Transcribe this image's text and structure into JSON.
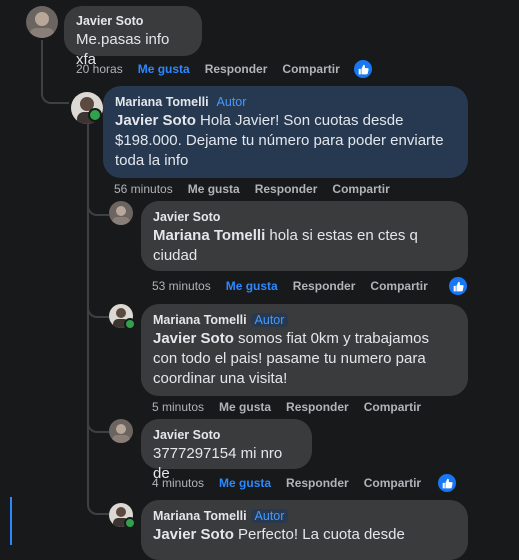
{
  "comments": [
    {
      "author": "Javier Soto",
      "text": "Me.pasas info xfa",
      "time": "20 horas"
    },
    {
      "author": "Mariana Tomelli",
      "badge": "Autor",
      "mention": "Javier Soto",
      "text": " Hola Javier! Son cuotas desde $198.000. Dejame tu número para poder enviarte toda la info",
      "time": "56 minutos"
    },
    {
      "author": "Javier Soto",
      "mention": "Mariana Tomelli",
      "text": " hola si estas en ctes q ciudad",
      "time": "53 minutos"
    },
    {
      "author": "Mariana Tomelli",
      "badge": "Autor",
      "mention": "Javier Soto",
      "text": " somos fiat 0km y trabajamos con todo el pais! pasame tu numero para coordinar una visita!",
      "time": "5 minutos"
    },
    {
      "author": "Javier Soto",
      "text": "3777297154 mi nro de",
      "time": "4 minutos"
    },
    {
      "author": "Mariana Tomelli",
      "badge": "Autor",
      "mention": "Javier Soto",
      "text": " Perfecto! La cuota desde"
    }
  ],
  "actions": {
    "like": "Me gusta",
    "reply": "Responder",
    "share": "Compartir"
  },
  "colors": {
    "background": "#18191a",
    "bubble": "#3a3b3c",
    "author_bubble": "#263951",
    "accent": "#2d88ff"
  }
}
